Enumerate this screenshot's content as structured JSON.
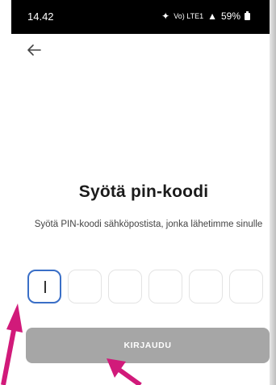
{
  "status_bar": {
    "time": "14.42",
    "signal_text": "Vo) LTE1",
    "battery": "59%"
  },
  "header": {
    "back_icon": "arrow-left-icon"
  },
  "content": {
    "title": "Syötä pin-koodi",
    "subtitle": "Syötä PIN-koodi sähköpostista, jonka lähetimme sinulle"
  },
  "pin": {
    "digit_count": 6,
    "values": [
      "",
      "",
      "",
      "",
      "",
      ""
    ],
    "active_index": 0
  },
  "login_button": {
    "label": "KIRJAUDU",
    "color": "#a6a6a6"
  },
  "annotations": {
    "arrow_color": "#d11a7a"
  },
  "colors": {
    "focus_border": "#3a6fc7",
    "status_bar_bg": "#000000"
  }
}
